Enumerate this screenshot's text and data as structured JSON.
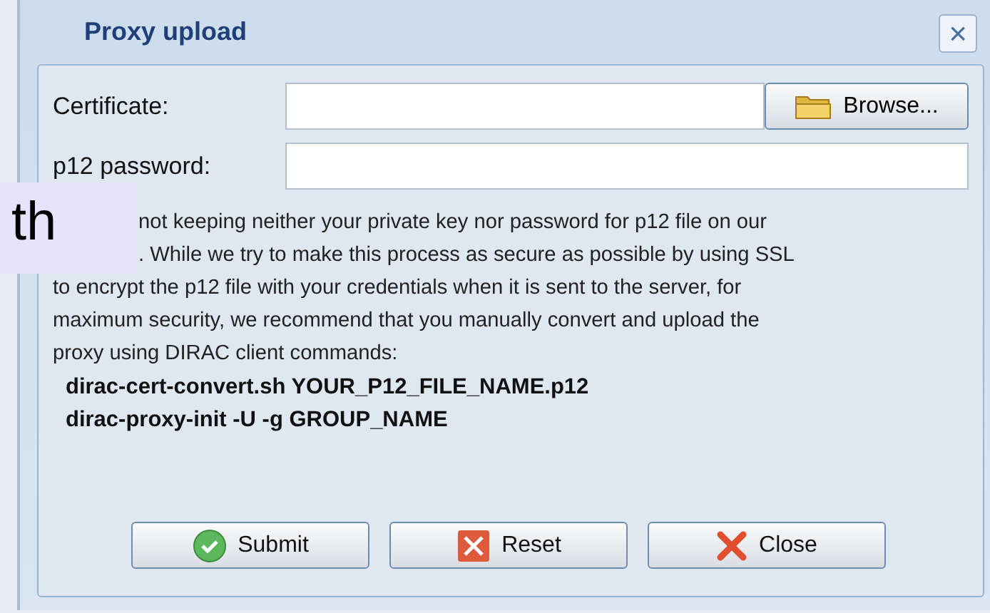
{
  "dialog": {
    "title": "Proxy upload",
    "close_icon": "×"
  },
  "fields": [
    {
      "label": "Certificate:",
      "kind": "file",
      "button": "Browse..."
    },
    {
      "label": "p12 password:",
      "kind": "password"
    }
  ],
  "notice_lines": [
    "not keeping neither your private key nor password for p12 file on our",
    ". While we try to make this process as secure as possible by using SSL",
    "to encrypt the p12 file with your credentials when it is sent to the server, for",
    "maximum security, we recommend that you manually convert and upload the",
    "proxy using DIRAC client commands:"
  ],
  "commands": [
    "dirac-cert-convert.sh YOUR_P12_FILE_NAME.p12",
    "dirac-proxy-init -U -g GROUP_NAME"
  ],
  "buttons": [
    {
      "label": "Submit",
      "kind": "submit"
    },
    {
      "label": "Reset",
      "kind": "reset"
    },
    {
      "label": "Close",
      "kind": "close"
    }
  ],
  "overlay": {
    "text": "th"
  }
}
